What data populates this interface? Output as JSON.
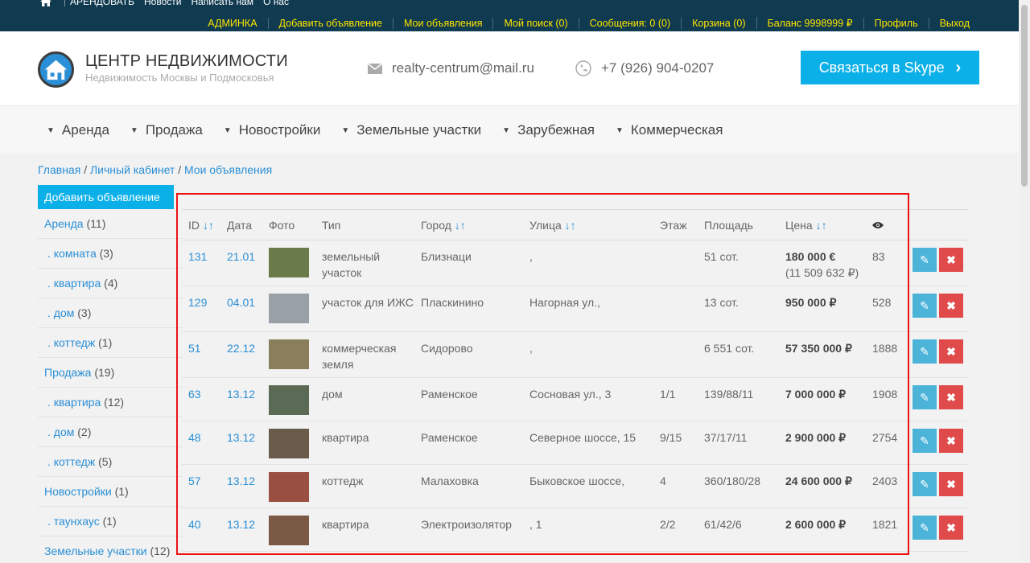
{
  "topbar": {
    "links": [
      "АРЕНДОВАТЬ",
      "Новости",
      "Написать нам",
      "О нас"
    ],
    "user_links": [
      "АДМИНКА",
      "Добавить объявление",
      "Мои объявления",
      "Мой поиск (0)",
      "Сообщения: 0 (0)",
      "Корзина (0)",
      "Баланс 9998999 ₽",
      "Профиль",
      "Выход"
    ]
  },
  "header": {
    "title": "ЦЕНТР НЕДВИЖИМОСТИ",
    "subtitle": "Недвижимость Москвы и Подмосковья",
    "email": "realty-centrum@mail.ru",
    "phone": "+7 (926) 904-0207",
    "skype_label": "Связаться в Skype",
    "skype_arrow": "›"
  },
  "nav": [
    "Аренда",
    "Продажа",
    "Новостройки",
    "Земельные участки",
    "Зарубежная",
    "Коммерческая"
  ],
  "breadcrumb": {
    "home": "Главная",
    "cabinet": "Личный кабинет",
    "current": "Мои объявления",
    "sep": "/"
  },
  "sidebar": {
    "head": "Добавить объявление",
    "items": [
      {
        "label": "Аренда",
        "count": "(11)",
        "sub": false
      },
      {
        "label": ". комната",
        "count": "(3)",
        "sub": true
      },
      {
        "label": ". квартира",
        "count": "(4)",
        "sub": true
      },
      {
        "label": ". дом",
        "count": "(3)",
        "sub": true
      },
      {
        "label": ". коттедж",
        "count": "(1)",
        "sub": true
      },
      {
        "label": "Продажа",
        "count": "(19)",
        "sub": false
      },
      {
        "label": ". квартира",
        "count": "(12)",
        "sub": true
      },
      {
        "label": ". дом",
        "count": "(2)",
        "sub": true
      },
      {
        "label": ". коттедж",
        "count": "(5)",
        "sub": true
      },
      {
        "label": "Новостройки",
        "count": "(1)",
        "sub": false
      },
      {
        "label": ". таунхаус",
        "count": "(1)",
        "sub": true
      },
      {
        "label": "Земельные участки",
        "count": "(12)",
        "sub": false
      }
    ]
  },
  "table": {
    "headers": {
      "id": "ID",
      "date": "Дата",
      "photo": "Фото",
      "type": "Тип",
      "city": "Город",
      "street": "Улица",
      "floor": "Этаж",
      "area": "Площадь",
      "price": "Цена"
    },
    "sort_glyph": "↓↑",
    "rows": [
      {
        "id": "131",
        "date": "21.01",
        "type": "земельный участок",
        "city": "Близнаци",
        "street": ",",
        "floor": "",
        "area": "51 сот.",
        "price": "180 000 €",
        "price2": "(11 509 632 ₽)",
        "views": "83",
        "photo": "#6b7a4a"
      },
      {
        "id": "129",
        "date": "04.01",
        "type": "участок для ИЖС",
        "city": "Пласкинино",
        "street": "Нагорная ул.,",
        "floor": "",
        "area": "13 сот.",
        "price": "950 000 ₽",
        "price2": "",
        "views": "528",
        "photo": "#9aa0a8"
      },
      {
        "id": "51",
        "date": "22.12",
        "type": "коммерческая земля",
        "city": "Сидорово",
        "street": ",",
        "floor": "",
        "area": "6 551 сот.",
        "price": "57 350 000 ₽",
        "price2": "",
        "views": "1888",
        "photo": "#8a7f5a"
      },
      {
        "id": "63",
        "date": "13.12",
        "type": "дом",
        "city": "Раменское",
        "street": "Сосновая ул., 3",
        "floor": "1/1",
        "area": "139/88/11",
        "price": "7 000 000 ₽",
        "price2": "",
        "views": "1908",
        "photo": "#5a6a55"
      },
      {
        "id": "48",
        "date": "13.12",
        "type": "квартира",
        "city": "Раменское",
        "street": "Северное шоссе, 15",
        "floor": "9/15",
        "area": "37/17/11",
        "price": "2 900 000 ₽",
        "price2": "",
        "views": "2754",
        "photo": "#6a5a4a"
      },
      {
        "id": "57",
        "date": "13.12",
        "type": "коттедж",
        "city": "Малаховка",
        "street": "Быковское шоссе,",
        "floor": "4",
        "area": "360/180/28",
        "price": "24 600 000 ₽",
        "price2": "",
        "views": "2403",
        "photo": "#9a5040"
      },
      {
        "id": "40",
        "date": "13.12",
        "type": "квартира",
        "city": "Электроизолятор",
        "street": ", 1",
        "floor": "2/2",
        "area": "61/42/6",
        "price": "2 600 000 ₽",
        "price2": "",
        "views": "1821",
        "photo": "#7a5a45"
      }
    ]
  },
  "icons": {
    "edit": "✎",
    "delete": "✖"
  }
}
